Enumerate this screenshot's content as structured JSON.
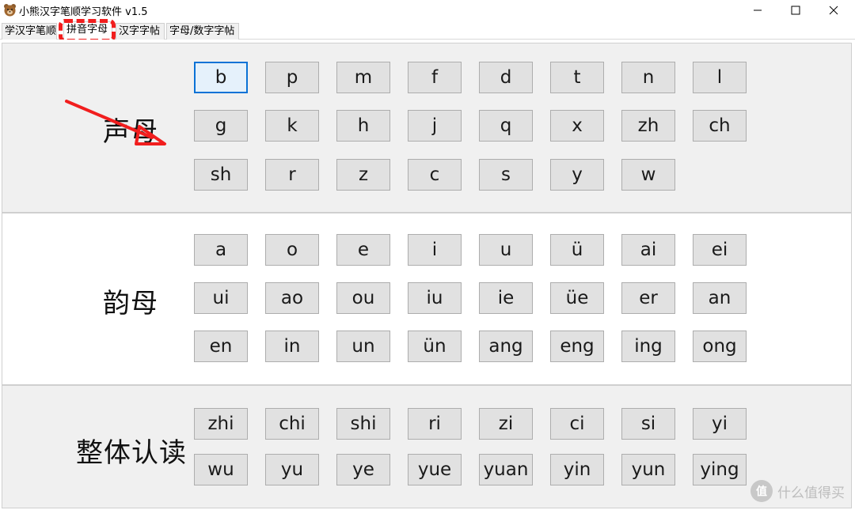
{
  "window": {
    "title": "小熊汉字笔顺学习软件 v1.5",
    "icon": "bear-icon"
  },
  "tabs": [
    {
      "label": "学汉字笔顺",
      "active": false
    },
    {
      "label": "拼音字母",
      "active": true
    },
    {
      "label": "汉字字帖",
      "active": false
    },
    {
      "label": "字母/数字字帖",
      "active": false
    }
  ],
  "sections": {
    "initials": {
      "label": "声母",
      "keys": [
        "b",
        "p",
        "m",
        "f",
        "d",
        "t",
        "n",
        "l",
        "g",
        "k",
        "h",
        "j",
        "q",
        "x",
        "zh",
        "ch",
        "sh",
        "r",
        "z",
        "c",
        "s",
        "y",
        "w"
      ]
    },
    "finals": {
      "label": "韵母",
      "keys": [
        "a",
        "o",
        "e",
        "i",
        "u",
        "ü",
        "ai",
        "ei",
        "ui",
        "ao",
        "ou",
        "iu",
        "ie",
        "üe",
        "er",
        "an",
        "en",
        "in",
        "un",
        "ün",
        "ang",
        "eng",
        "ing",
        "ong"
      ]
    },
    "whole": {
      "label": "整体认读",
      "keys": [
        "zhi",
        "chi",
        "shi",
        "ri",
        "zi",
        "ci",
        "si",
        "yi",
        "wu",
        "yu",
        "ye",
        "yue",
        "yuan",
        "yin",
        "yun",
        "ying"
      ]
    }
  },
  "focused_key": "b",
  "annotation": {
    "highlight_color": "#f11e1e",
    "arrow_color": "#f11e1e"
  },
  "watermark": {
    "icon_text": "值",
    "text": "什么值得买"
  }
}
